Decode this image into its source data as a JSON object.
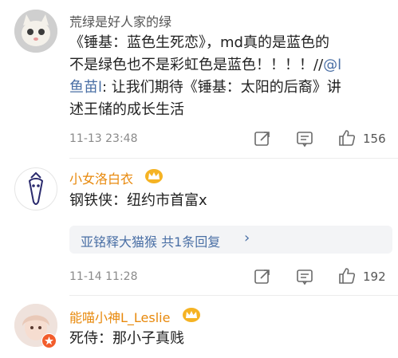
{
  "comments": [
    {
      "username": "荒绿是好人家的绿",
      "text_plain": "《锤基：蓝色生死恋》，md真的是蓝色的不是绿色也不是彩虹色是蓝色！！！！//",
      "mention": "@l鱼苗l",
      "text_after": ": 让我们期待《锤基：太阳的后裔》讲述王储的成长生活",
      "lines": [
        "《锤基：蓝色生死恋》，md真的是蓝色的",
        "不是绿色也不是彩虹色是蓝色！！！！//",
        "鱼苗l: 让我们期待《锤基：太阳的后裔》讲",
        "述王储的成长生活"
      ],
      "line2_mention_part": "@l",
      "line3_mention_part": "鱼苗l",
      "timestamp": "11-13 23:48",
      "like_count": "156"
    },
    {
      "username": "小女洛白衣",
      "text": "钢铁侠：纽约市首富x",
      "reply_summary": "亚铭释大猫猴  共1条回复",
      "reply_chevron": "›",
      "timestamp": "11-14 11:28",
      "like_count": "192"
    },
    {
      "username": "能喵小神L_Leslie",
      "text": "死侍：那小子真贱"
    }
  ],
  "colors": {
    "link": "#4a6fa5",
    "username_vip": "#e8890c",
    "username_normal": "#555555",
    "crown": "#f5b324"
  },
  "icons": [
    "share-icon",
    "comment-icon",
    "like-icon",
    "crown-icon"
  ]
}
